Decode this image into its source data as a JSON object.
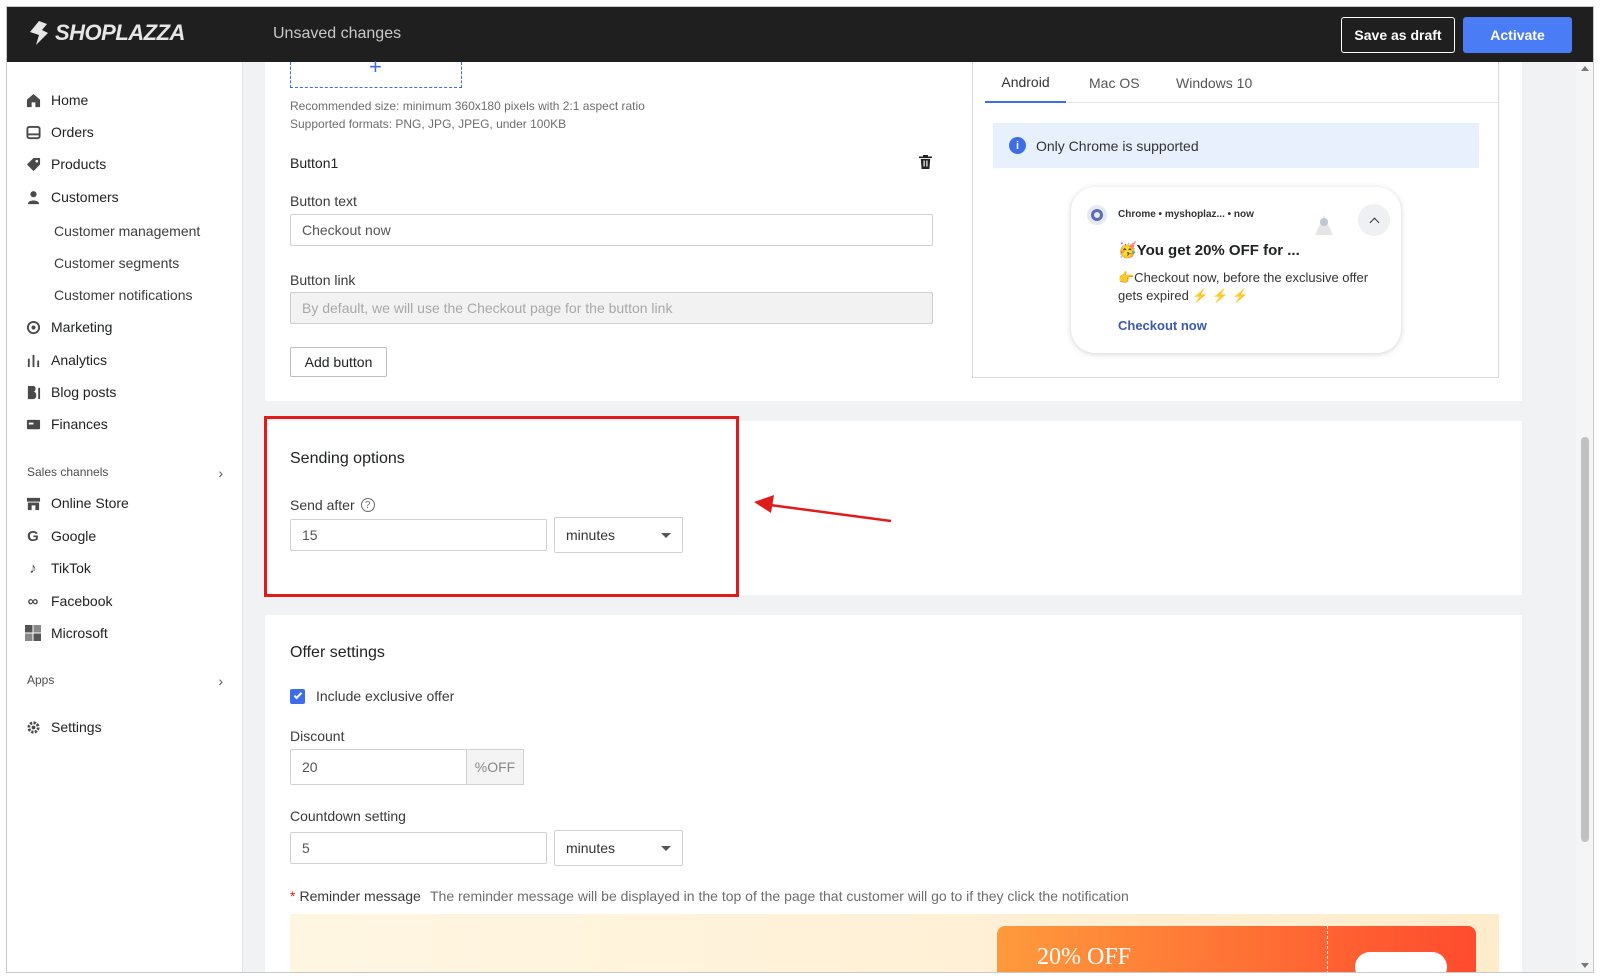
{
  "header": {
    "brand": "SHOPLAZZA",
    "status": "Unsaved changes",
    "save_draft": "Save as draft",
    "activate": "Activate"
  },
  "sidebar": {
    "items": [
      {
        "label": "Home",
        "icon": "home-icon"
      },
      {
        "label": "Orders",
        "icon": "orders-icon"
      },
      {
        "label": "Products",
        "icon": "tag-icon"
      },
      {
        "label": "Customers",
        "icon": "person-icon"
      }
    ],
    "customer_sub": [
      "Customer management",
      "Customer segments",
      "Customer notifications"
    ],
    "items2": [
      {
        "label": "Marketing",
        "icon": "marketing-icon"
      },
      {
        "label": "Analytics",
        "icon": "analytics-icon"
      },
      {
        "label": "Blog posts",
        "icon": "blog-icon"
      },
      {
        "label": "Finances",
        "icon": "finances-icon"
      }
    ],
    "sales_channels": "Sales channels",
    "channels": [
      {
        "label": "Online Store",
        "icon": "store-icon"
      },
      {
        "label": "Google",
        "icon": "google-icon"
      },
      {
        "label": "TikTok",
        "icon": "tiktok-icon"
      },
      {
        "label": "Facebook",
        "icon": "meta-icon"
      },
      {
        "label": "Microsoft",
        "icon": "microsoft-icon"
      }
    ],
    "apps": "Apps",
    "settings": "Settings"
  },
  "image_block": {
    "hint1": "Recommended size: minimum 360x180 pixels with 2:1 aspect ratio",
    "hint2": "Supported formats: PNG, JPG, JPEG, under 100KB"
  },
  "button1": {
    "title": "Button1",
    "text_label": "Button text",
    "text_value": "Checkout now",
    "link_label": "Button link",
    "link_placeholder": "By default, we will use the Checkout page for the button link",
    "add_button": "Add button"
  },
  "preview": {
    "tabs": [
      "Android",
      "Mac OS",
      "Windows 10"
    ],
    "active_tab": "Android",
    "notice": "Only Chrome is supported",
    "notif_source": "Chrome • myshoplaz... • now",
    "notif_title": "🥳You get 20% OFF for ...",
    "notif_body": "👉Checkout now, before the exclusive offer gets expired ⚡ ⚡ ⚡",
    "notif_action": "Checkout now"
  },
  "sending": {
    "title": "Sending options",
    "send_after_label": "Send after",
    "send_after_value": "15",
    "unit": "minutes"
  },
  "offer": {
    "title": "Offer settings",
    "include_label": "Include exclusive offer",
    "include_checked": true,
    "discount_label": "Discount",
    "discount_value": "20",
    "discount_suffix": "%OFF",
    "countdown_label": "Countdown setting",
    "countdown_value": "5",
    "countdown_unit": "minutes",
    "reminder_label": "Reminder message",
    "reminder_required": "*",
    "reminder_hint": "The reminder message will be displayed in the top of the page that customer will go to if they click the notification",
    "banner_text": "20% OFF"
  },
  "colors": {
    "accent": "#4a7cf6",
    "highlight": "#e01b1b"
  }
}
